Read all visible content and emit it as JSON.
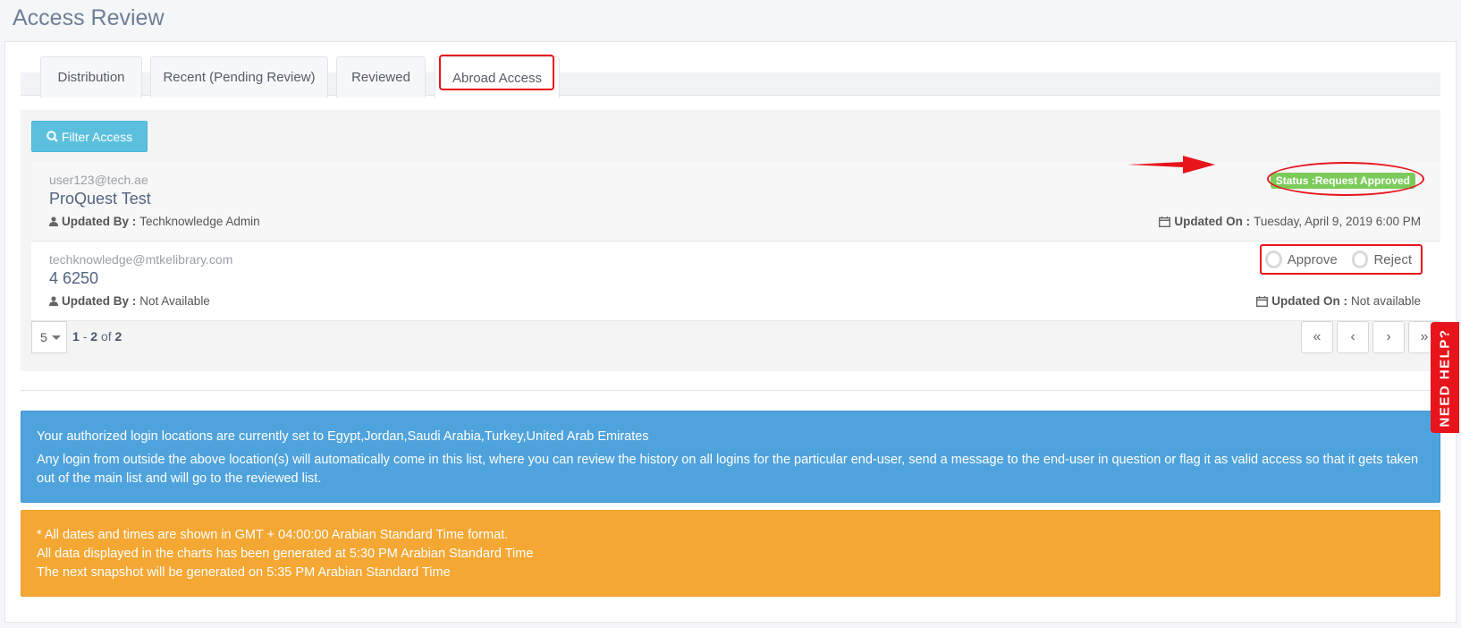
{
  "page": {
    "title": "Access Review"
  },
  "tabs": [
    {
      "label": "Distribution"
    },
    {
      "label": "Recent (Pending Review)"
    },
    {
      "label": "Reviewed"
    },
    {
      "label": "Abroad Access"
    }
  ],
  "filter": {
    "label": "Filter Access",
    "icon": "search-icon"
  },
  "records": [
    {
      "email": "user123@tech.ae",
      "name": "ProQuest Test",
      "updated_by_label": "Updated By :",
      "updated_by": "Techknowledge Admin",
      "updated_on_label": "Updated On :",
      "updated_on": "Tuesday, April 9, 2019 6:00 PM",
      "status": "Status :Request Approved"
    },
    {
      "email": "techknowledge@mtkelibrary.com",
      "name": "4 6250",
      "updated_by_label": "Updated By :",
      "updated_by": "Not Available",
      "updated_on_label": "Updated On :",
      "updated_on": "Not available",
      "approve_label": "Approve",
      "reject_label": "Reject"
    }
  ],
  "pagination": {
    "per_page": "5",
    "from": "1",
    "separator": "-",
    "to": "2",
    "of_label": "of",
    "total": "2",
    "buttons": {
      "first": "«",
      "prev": "‹",
      "next": "›",
      "last": "»"
    }
  },
  "info": {
    "line1": "Your authorized login locations are currently set to Egypt,Jordan,Saudi Arabia,Turkey,United Arab Emirates",
    "line2": "Any login from outside the above location(s) will automatically come in this list, where you can review the history on all logins for the particular end-user, send a message to the end-user in question or flag it as valid access so that it gets taken out of the main list and will go to the reviewed list."
  },
  "notes": [
    "* All dates and times are shown in GMT + 04:00:00 Arabian Standard Time format.",
    "All data displayed in the charts has been generated at 5:30 PM Arabian Standard Time",
    "The next snapshot will be generated on 5:35 PM Arabian Standard Time"
  ],
  "need_help": {
    "label": "NEED HELP?"
  },
  "colors": {
    "accent": "#5bc0de",
    "info": "#4fa3dc",
    "warning": "#f4a733",
    "success": "#7ccb5a",
    "highlight": "#e8141b"
  }
}
